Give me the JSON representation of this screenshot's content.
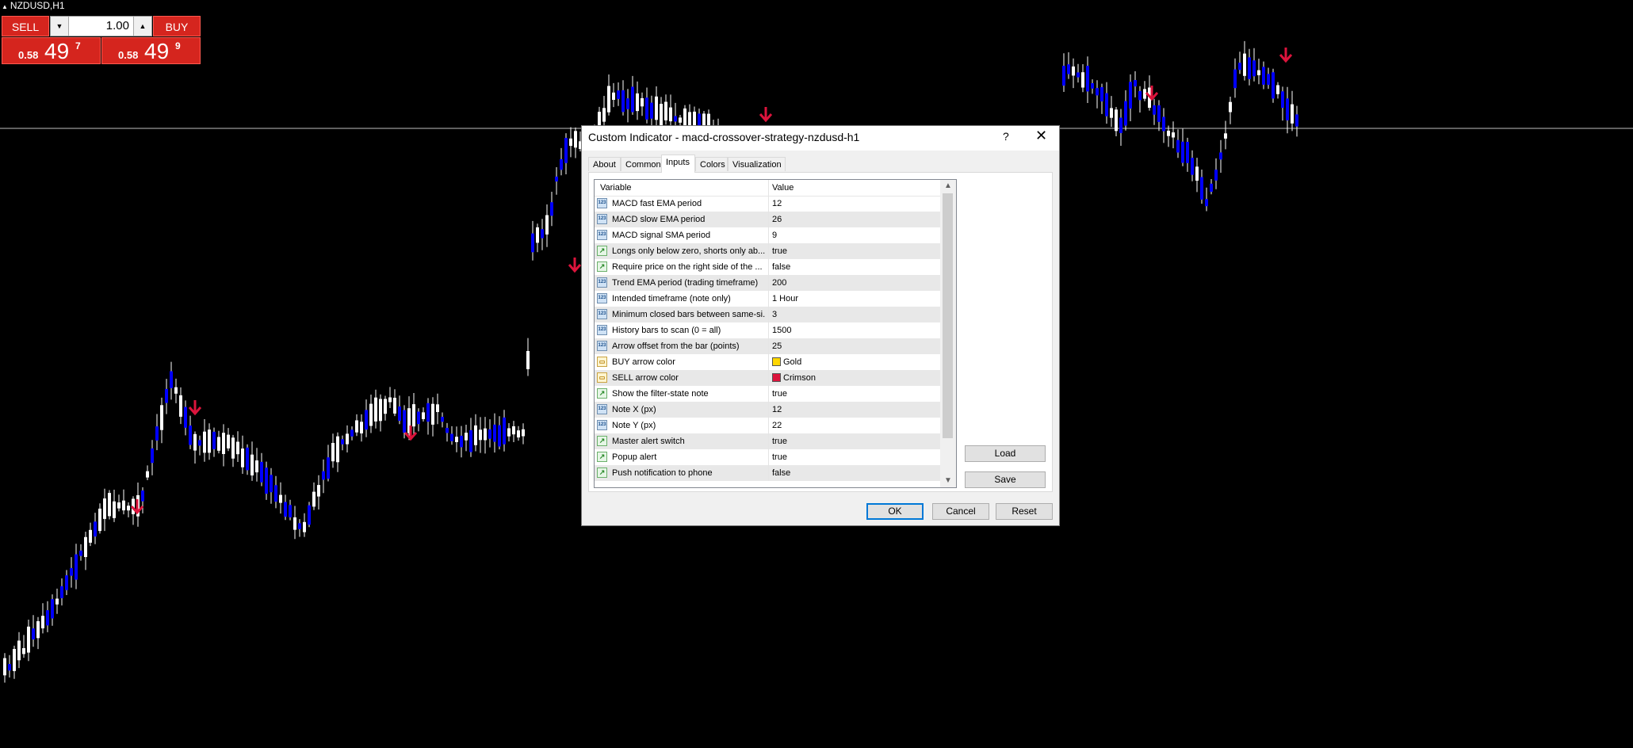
{
  "chart": {
    "symbol": "NZDUSD,H1",
    "colors": {
      "bull": "#0000ff",
      "bear": "#ffffff",
      "wick": "#ffffff",
      "arrow": "#dc143c",
      "hline": "#c0c0c0",
      "doji": "#00ff00"
    }
  },
  "trade_panel": {
    "sell_label": "SELL",
    "buy_label": "BUY",
    "lot": "1.00",
    "sell_price": {
      "small": "0.58",
      "big": "49",
      "sup": "7"
    },
    "buy_price": {
      "small": "0.58",
      "big": "49",
      "sup": "9"
    },
    "down_glyph": "▼",
    "up_glyph": "▲"
  },
  "dialog": {
    "title": "Custom Indicator - macd-crossover-strategy-nzdusd-h1",
    "help": "?",
    "close": "✕",
    "tabs": [
      "About",
      "Common",
      "Inputs",
      "Colors",
      "Visualization"
    ],
    "active_tab": "Inputs",
    "columns": {
      "variable": "Variable",
      "value": "Value"
    },
    "rows": [
      {
        "type": "int",
        "name": "MACD fast EMA period",
        "value": "12"
      },
      {
        "type": "int",
        "name": "MACD slow EMA period",
        "value": "26"
      },
      {
        "type": "int",
        "name": "MACD signal SMA period",
        "value": "9"
      },
      {
        "type": "bool",
        "name": "Longs only below zero, shorts only ab...",
        "value": "true"
      },
      {
        "type": "bool",
        "name": "Require price on the right side of the ...",
        "value": "false"
      },
      {
        "type": "int",
        "name": "Trend EMA period (trading timeframe)",
        "value": "200"
      },
      {
        "type": "int",
        "name": "Intended timeframe (note only)",
        "value": "1 Hour"
      },
      {
        "type": "int",
        "name": "Minimum closed bars between same-si...",
        "value": "3"
      },
      {
        "type": "int",
        "name": "History bars to scan (0 = all)",
        "value": "1500"
      },
      {
        "type": "int",
        "name": "Arrow offset from the bar (points)",
        "value": "25"
      },
      {
        "type": "color",
        "name": "BUY arrow color",
        "value": "Gold",
        "swatch": "#ffd700"
      },
      {
        "type": "color",
        "name": "SELL arrow color",
        "value": "Crimson",
        "swatch": "#dc143c"
      },
      {
        "type": "bool",
        "name": "Show the filter-state note",
        "value": "true"
      },
      {
        "type": "int",
        "name": "Note X (px)",
        "value": "12"
      },
      {
        "type": "int",
        "name": "Note Y (px)",
        "value": "22"
      },
      {
        "type": "bool",
        "name": "Master alert switch",
        "value": "true"
      },
      {
        "type": "bool",
        "name": "Popup alert",
        "value": "true"
      },
      {
        "type": "bool",
        "name": "Push notification to phone",
        "value": "false"
      }
    ],
    "buttons": {
      "load": "Load",
      "save": "Save",
      "ok": "OK",
      "cancel": "Cancel",
      "reset": "Reset"
    },
    "icon_text": {
      "int": "123",
      "bool": "↗",
      "color": "▭"
    },
    "scroll_up": "▲",
    "scroll_down": "▼"
  }
}
